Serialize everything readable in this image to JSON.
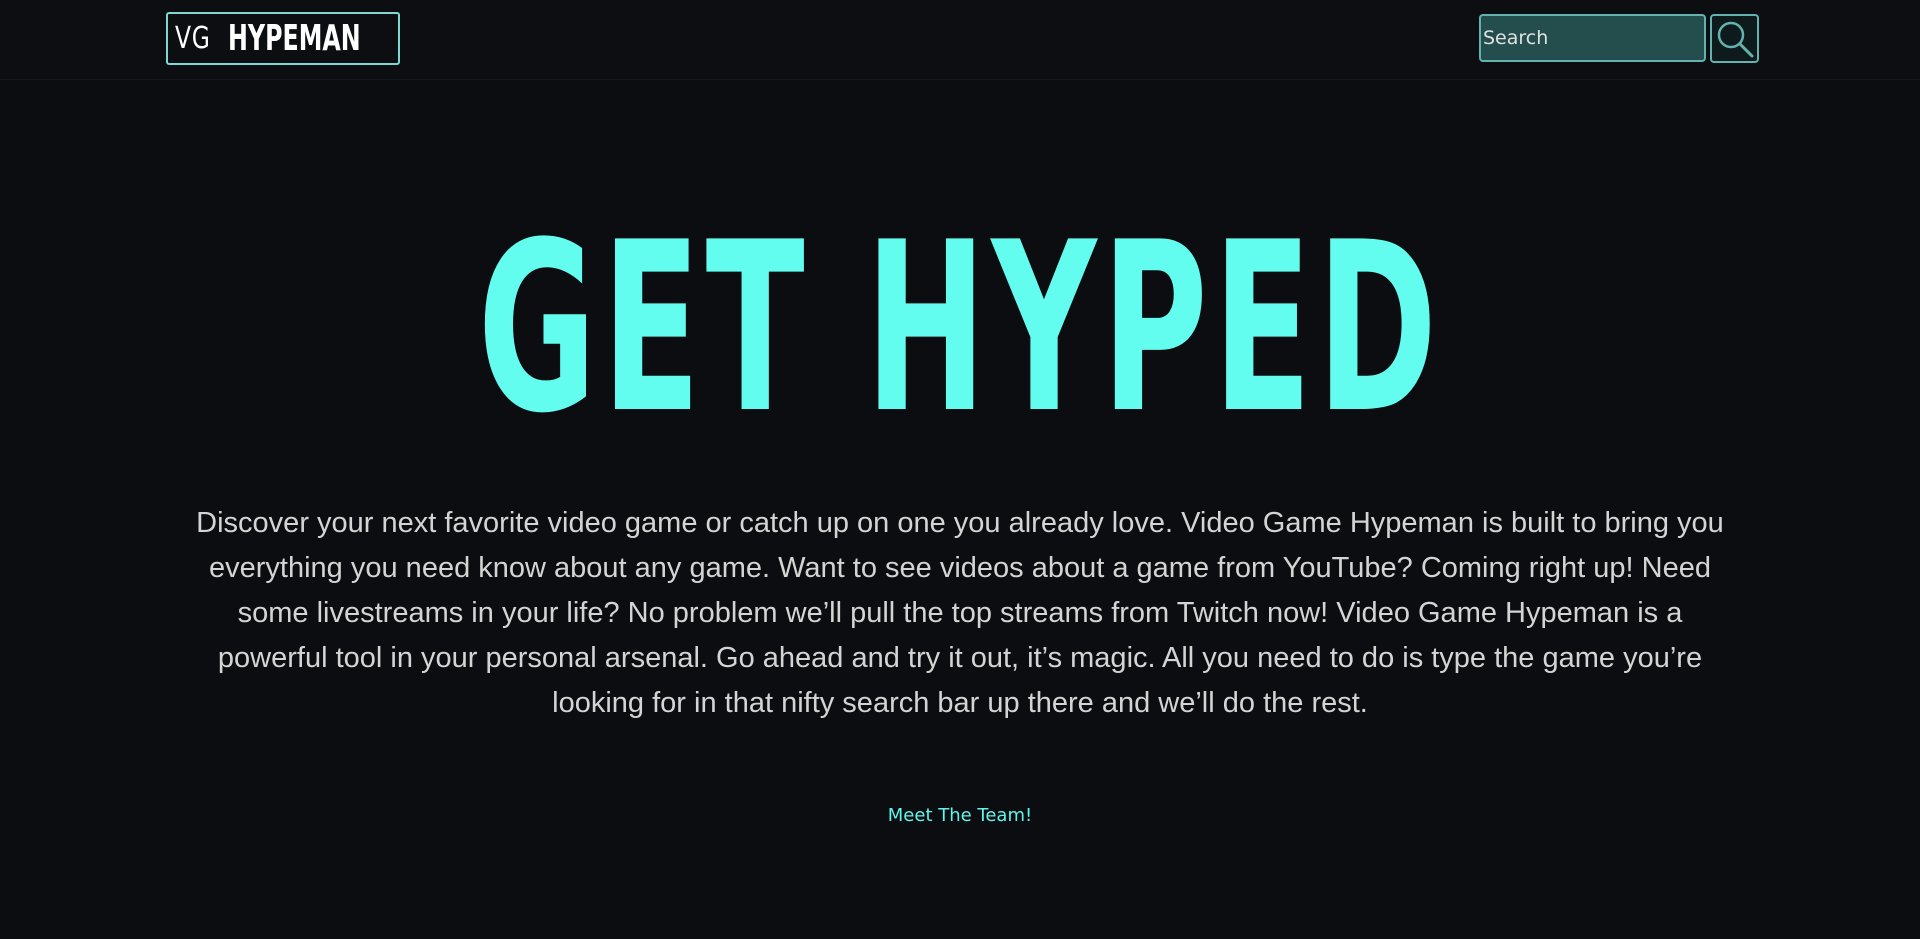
{
  "navbar": {
    "logo": {
      "prefix": "VG",
      "name": "HYPEMAN"
    },
    "search": {
      "placeholder": "Search",
      "button_icon": "search-icon"
    }
  },
  "hero": {
    "title": "GET HYPED",
    "description": "Discover your next favorite video game or catch up on one you already love. Video Game Hypeman is built to bring you everything you need know about any game. Want to see videos about a game from YouTube? Coming right up! Need some livestreams in your life? No problem we’ll pull the top streams from Twitch now! Video Game Hypeman is a powerful tool in your personal arsenal. Go ahead and try it out, it’s magic. All you need to do is type the game you’re looking for in that nifty search bar up there and we’ll do the rest."
  },
  "footer_link": {
    "label": "Meet The Team!"
  },
  "colors": {
    "background": "#0b0d11",
    "accent": "#63fdf0",
    "search_bg": "#244d4d",
    "border": "#62b3b0",
    "text": "#d4d4d4"
  }
}
